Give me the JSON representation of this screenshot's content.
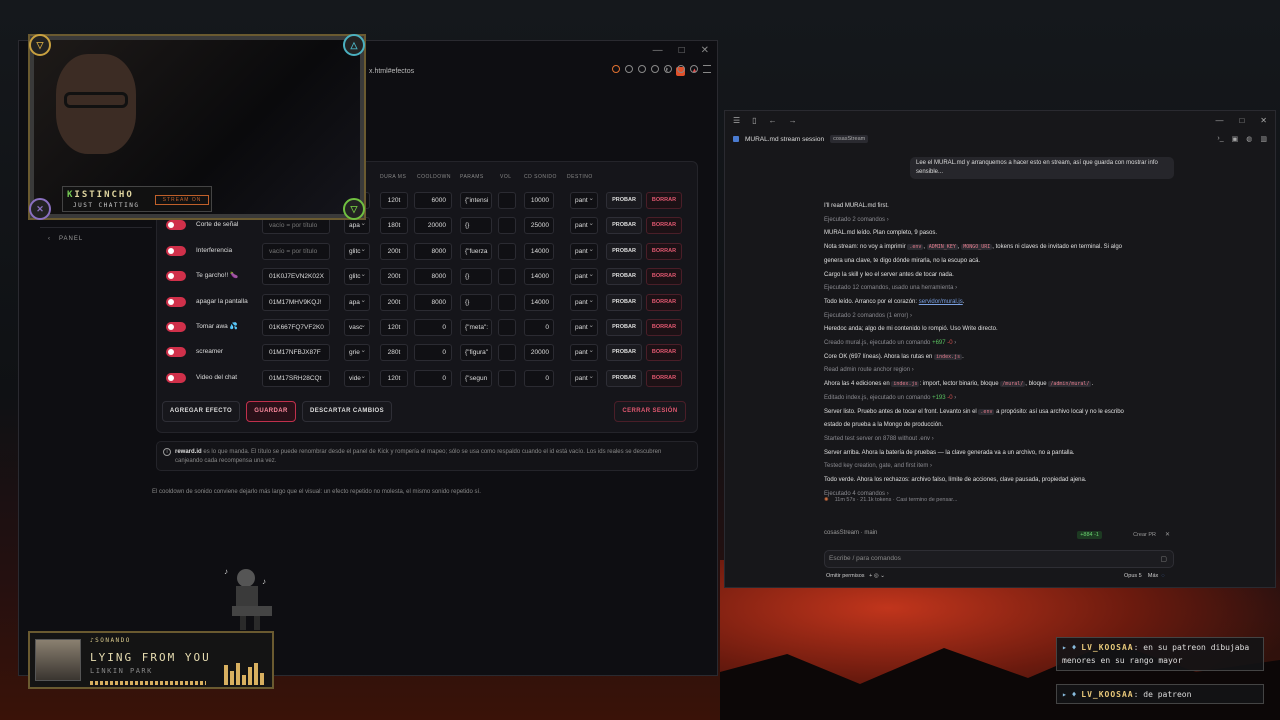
{
  "browser": {
    "url": "x.html#efectos",
    "panel_label": "PANEL",
    "columns": [
      "DURA MS",
      "COOLDOWN",
      "PARAMS",
      "VOL",
      "CD SONIDO",
      "DESTINO"
    ],
    "rows": [
      {
        "name": "",
        "reward_id": "",
        "selector": "",
        "duration": "120t",
        "cooldown": "6000",
        "params": "{\"intensi",
        "cd_sonido": "10000",
        "destino": "pant"
      },
      {
        "name": "Corte de señal",
        "reward_id": "vacío = por título",
        "selector": "apa",
        "duration": "180t",
        "cooldown": "20000",
        "params": "{}",
        "cd_sonido": "25000",
        "destino": "pant"
      },
      {
        "name": "Interferencia",
        "reward_id": "vacío = por título",
        "selector": "glitc",
        "duration": "200t",
        "cooldown": "8000",
        "params": "{\"fuerza",
        "cd_sonido": "14000",
        "destino": "pant"
      },
      {
        "name": "Te garcho!! 🍆",
        "reward_id": "01K0J7EVN2K02X",
        "selector": "glitc",
        "duration": "200t",
        "cooldown": "8000",
        "params": "{}",
        "cd_sonido": "14000",
        "destino": "pant"
      },
      {
        "name": "apagar la pantalla",
        "reward_id": "01M17MHV9KQJ!",
        "selector": "apa",
        "duration": "200t",
        "cooldown": "8000",
        "params": "{}",
        "cd_sonido": "14000",
        "destino": "pant"
      },
      {
        "name": "Tomar awa 💦",
        "reward_id": "01K667FQ7VF2K0",
        "selector": "vasc",
        "duration": "120t",
        "cooldown": "0",
        "params": "{\"meta\":",
        "cd_sonido": "0",
        "destino": "pant"
      },
      {
        "name": "screamer",
        "reward_id": "01M17NFBJX87F",
        "selector": "grie",
        "duration": "280t",
        "cooldown": "0",
        "params": "{\"figura\"",
        "cd_sonido": "20000",
        "destino": "pant"
      },
      {
        "name": "Video del chat",
        "reward_id": "01M17SRH28CQt",
        "selector": "vide",
        "duration": "120t",
        "cooldown": "0",
        "params": "{\"segun",
        "cd_sonido": "0",
        "destino": "pant"
      }
    ],
    "probar_label": "PROBAR",
    "borrar_label": "BORRAR",
    "add_label": "AGREGAR EFECTO",
    "save_label": "GUARDAR",
    "discard_label": "DESCARTAR CAMBIOS",
    "logout_label": "CERRAR SESIÓN",
    "info_bold": "reward.id",
    "info_text": " es lo que manda. El título se puede renombrar desde el panel de Kick y rompería el mapeo; sólo se usa como respaldo cuando el id está vacío. Los ids reales se descubren canjeando cada recompensa una vez.",
    "cooldown_note": "El cooldown de sonido conviene dejarlo más largo que el visual: un efecto repetido no molesta, el mismo sonido repetido sí."
  },
  "overlay": {
    "streamer_name": "ISTINCHO",
    "streamer_initial": "K",
    "category": "JUST CHATTING",
    "badge": "STREAM ON",
    "now_playing_label": "♪SONANDO",
    "song": "LYING FROM YOU",
    "artist": "LINKIN PARK",
    "song_progress": 0.95
  },
  "agent": {
    "session_title": "MURAL.md stream session",
    "session_tag": "cosasStream",
    "user_message": "Lee el MURAL.md y arranquemos a hacer esto en stream, así que guarda con mostrar info sensible...",
    "status": "11m 57s · 21.1k tokens · Casi termino de pensar...",
    "repo": "cosasStream · main",
    "diff": "+884 -1",
    "create_pr": "Crear PR",
    "prompt_placeholder": "Escribe / para comandos",
    "permissions": "Omitir permisos",
    "model": "Opus 5",
    "effort": "Máx"
  },
  "chat": [
    {
      "user": "LV_KOOSAA",
      "text": ": en su patreon dibujaba menores en su rango mayor"
    },
    {
      "user": "LV_KOOSAA",
      "text": ": de patreon"
    }
  ]
}
